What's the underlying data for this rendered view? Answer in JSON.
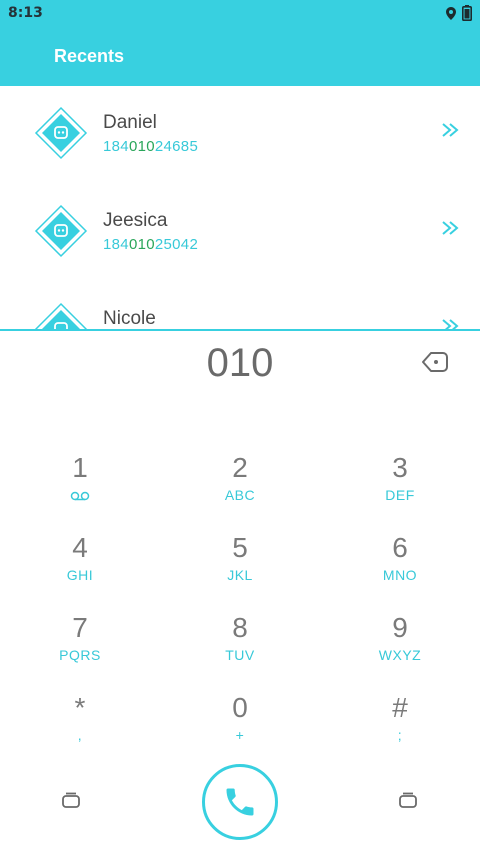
{
  "status_bar": {
    "time": "8:13",
    "icons": [
      "location-icon",
      "battery-icon"
    ]
  },
  "app_bar": {
    "title": "Recents"
  },
  "recents": [
    {
      "name": "Daniel",
      "number_prefix": "184",
      "number_match": "010",
      "number_suffix": "24685"
    },
    {
      "name": "Jeesica",
      "number_prefix": "184",
      "number_match": "010",
      "number_suffix": "25042"
    },
    {
      "name": "Nicole",
      "number_prefix": "",
      "number_match": "",
      "number_suffix": ""
    }
  ],
  "dialer": {
    "digits": "010"
  },
  "keypad": [
    {
      "digit": "1",
      "letters": ""
    },
    {
      "digit": "2",
      "letters": "ABC"
    },
    {
      "digit": "3",
      "letters": "DEF"
    },
    {
      "digit": "4",
      "letters": "GHI"
    },
    {
      "digit": "5",
      "letters": "JKL"
    },
    {
      "digit": "6",
      "letters": "MNO"
    },
    {
      "digit": "7",
      "letters": "PQRS"
    },
    {
      "digit": "8",
      "letters": "TUV"
    },
    {
      "digit": "9",
      "letters": "WXYZ"
    },
    {
      "digit": "*",
      "letters": ","
    },
    {
      "digit": "0",
      "letters": "+"
    },
    {
      "digit": "#",
      "letters": ";"
    }
  ],
  "colors": {
    "accent": "#38d0e0",
    "match": "#2aa65a",
    "digit": "#7a7a7a"
  }
}
